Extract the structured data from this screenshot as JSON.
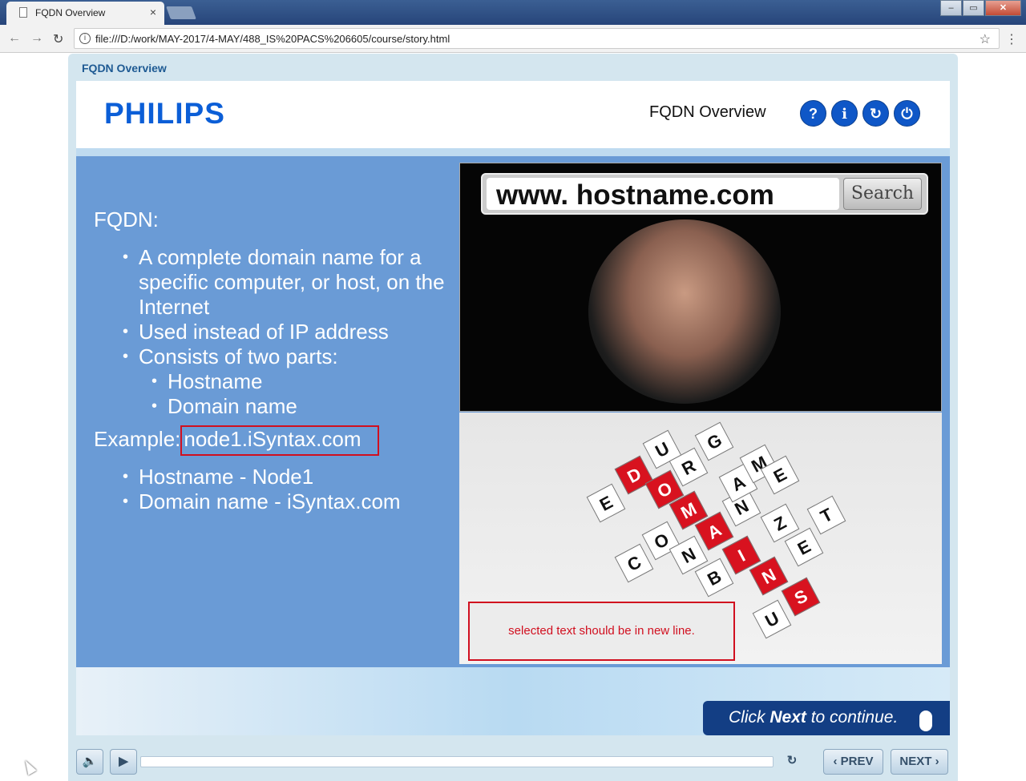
{
  "browser": {
    "tab_title": "FQDN Overview",
    "tab_close": "×",
    "url": "file:///D:/work/MAY-2017/4-MAY/488_IS%20PACS%206605/course/story.html",
    "window_buttons": [
      "–",
      "▭",
      "✕"
    ]
  },
  "player": {
    "title": "FQDN Overview",
    "header_title": "FQDN Overview",
    "logo": "PHILIPS",
    "header_icons": [
      {
        "name": "help-icon",
        "glyph": "?"
      },
      {
        "name": "info-icon",
        "glyph": "i"
      },
      {
        "name": "replay-icon",
        "glyph": "↻"
      },
      {
        "name": "power-icon",
        "glyph": "⏻"
      }
    ]
  },
  "slide": {
    "heading": "FQDN:",
    "bullets": [
      "A complete domain name for a specific computer, or host, on the Internet",
      "Used instead of IP address",
      "Consists of two parts:"
    ],
    "sub_bullets": [
      "Hostname",
      "Domain name"
    ],
    "example_label": "Example:",
    "example_value": "node1.iSyntax.com",
    "example_bullets": [
      "Hostname - Node1",
      "Domain name - iSyntax.com"
    ],
    "search_text": "www. hostname.com",
    "search_button": "Search",
    "cube_letters": {
      "red": [
        "D",
        "O",
        "M",
        "A",
        "I",
        "N",
        "S"
      ],
      "white": [
        "E",
        "U",
        "R",
        "G",
        "C",
        "O",
        "N",
        "B",
        "N",
        "A",
        "M",
        "E",
        "Z",
        "E",
        "T",
        "U"
      ]
    },
    "review_note": "selected text should be in new line."
  },
  "footer": {
    "hint_pre": "Click ",
    "hint_bold": "Next",
    "hint_post": " to continue.",
    "prev_label": "‹ PREV",
    "next_label": "NEXT ›"
  }
}
